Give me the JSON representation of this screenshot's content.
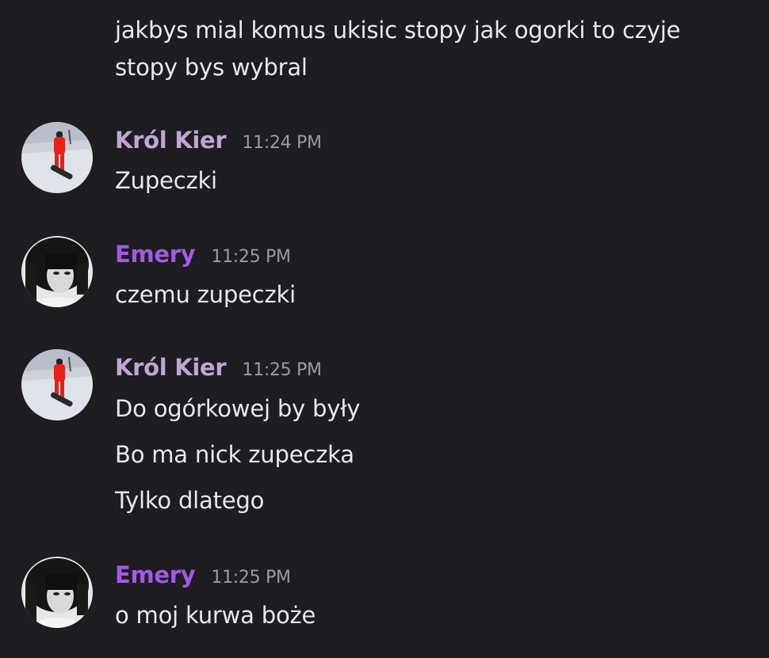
{
  "colors": {
    "background": "#1c1c21",
    "text": "#e9e9ec",
    "timestamp": "#9a9aa3",
    "krol_kier_name": "#c1a5d6",
    "emery_name": "#a35ae0"
  },
  "messages": [
    {
      "continuation": true,
      "lines": [
        "jakbys mial komus ukisic stopy jak ogorki to czyje",
        "stopy bys wybral"
      ]
    },
    {
      "author": "Król Kier",
      "avatar": "snowboarder-avatar",
      "time": "11:24 PM",
      "lines": [
        "Zupeczki"
      ]
    },
    {
      "author": "Emery",
      "avatar": "bw-portrait-avatar",
      "time": "11:25 PM",
      "lines": [
        "czemu zupeczki"
      ]
    },
    {
      "author": "Król Kier",
      "avatar": "snowboarder-avatar",
      "time": "11:25 PM",
      "lines": [
        "Do ogórkowej by były",
        "Bo ma nick zupeczka",
        "Tylko dlatego"
      ]
    },
    {
      "author": "Emery",
      "avatar": "bw-portrait-avatar",
      "time": "11:25 PM",
      "lines": [
        "o moj kurwa boże"
      ]
    }
  ]
}
